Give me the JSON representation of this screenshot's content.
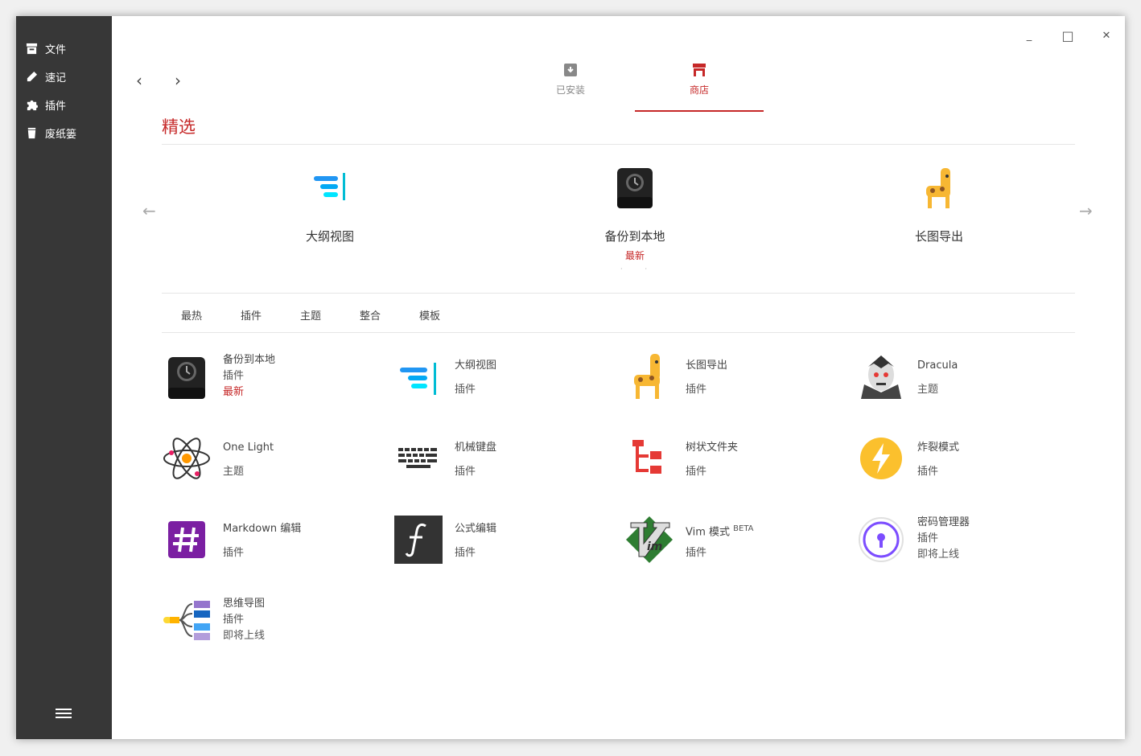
{
  "sidebar": {
    "items": [
      {
        "label": "文件",
        "icon": "archive-icon"
      },
      {
        "label": "速记",
        "icon": "pencil-icon"
      },
      {
        "label": "插件",
        "icon": "puzzle-icon"
      },
      {
        "label": "废纸篓",
        "icon": "trash-icon"
      }
    ],
    "menu_icon": "hamburger-icon"
  },
  "window_controls": {
    "minimize": "_",
    "maximize": "□",
    "close": "✕"
  },
  "nav": {
    "back": "‹",
    "forward": "›"
  },
  "tabs": [
    {
      "label": "已安装",
      "icon": "download-box-icon",
      "active": false
    },
    {
      "label": "商店",
      "icon": "store-icon",
      "active": true
    }
  ],
  "featured": {
    "title": "精选",
    "items": [
      {
        "label": "大纲视图",
        "badge": "",
        "icon": "outline-icon"
      },
      {
        "label": "备份到本地",
        "badge": "最新",
        "icon": "backup-drive-icon"
      },
      {
        "label": "长图导出",
        "badge": "",
        "icon": "giraffe-icon"
      }
    ],
    "prev": "←",
    "next": "→"
  },
  "categories": [
    "最热",
    "插件",
    "主题",
    "整合",
    "模板"
  ],
  "grid": [
    {
      "name": "备份到本地",
      "type": "插件",
      "status": "最新",
      "icon": "backup-drive-icon"
    },
    {
      "name": "大纲视图",
      "type": "插件",
      "status": "",
      "icon": "outline-icon"
    },
    {
      "name": "长图导出",
      "type": "插件",
      "status": "",
      "icon": "giraffe-icon"
    },
    {
      "name": "Dracula",
      "type": "主题",
      "status": "",
      "icon": "dracula-icon"
    },
    {
      "name": "One Light",
      "type": "主题",
      "status": "",
      "icon": "atom-icon"
    },
    {
      "name": "机械键盘",
      "type": "插件",
      "status": "",
      "icon": "keyboard-icon"
    },
    {
      "name": "树状文件夹",
      "type": "插件",
      "status": "",
      "icon": "tree-folder-icon"
    },
    {
      "name": "炸裂模式",
      "type": "插件",
      "status": "",
      "icon": "lightning-icon"
    },
    {
      "name": "Markdown 编辑",
      "type": "插件",
      "status": "",
      "icon": "hash-icon"
    },
    {
      "name": "公式编辑",
      "type": "插件",
      "status": "",
      "icon": "function-icon"
    },
    {
      "name": "Vim 模式",
      "sup": "BETA",
      "type": "插件",
      "status": "",
      "icon": "vim-icon"
    },
    {
      "name": "密码管理器",
      "type": "插件",
      "status": "即将上线",
      "icon": "keyhole-icon"
    },
    {
      "name": "思维导图",
      "type": "插件",
      "status": "即将上线",
      "icon": "mindmap-icon"
    }
  ],
  "colors": {
    "accent": "#c62828",
    "sidebar": "#373737"
  }
}
